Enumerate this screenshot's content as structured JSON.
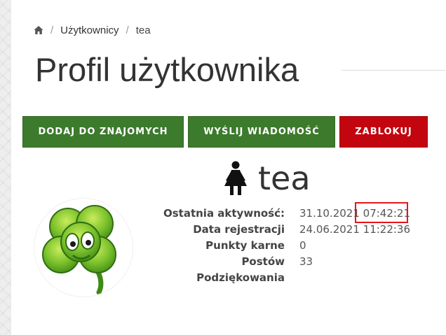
{
  "breadcrumb": {
    "home_icon": "home-icon",
    "items": [
      "Użytkownicy",
      "tea"
    ]
  },
  "title": "Profil użytkownika",
  "actions": {
    "add_friend": "DODAJ DO ZNAJOMYCH",
    "send_message": "WYŚLIJ WIADOMOŚĆ",
    "block": "ZABLOKUJ"
  },
  "colors": {
    "green_button": "#3c7a2c",
    "red_button": "#c2050f",
    "highlight": "#e8141b"
  },
  "profile": {
    "gender_icon": "female-icon",
    "username": "tea",
    "avatar": "four-leaf-clover-avatar",
    "fields": [
      {
        "label": "Ostatnia aktywność:",
        "value": "31.10.2021 07:42:21"
      },
      {
        "label": "Data rejestracji",
        "value": "24.06.2021 11:22:36"
      },
      {
        "label": "Punkty karne",
        "value": "0"
      },
      {
        "label": "Postów",
        "value": "33"
      },
      {
        "label": "Podziękowania",
        "value": ""
      }
    ]
  }
}
